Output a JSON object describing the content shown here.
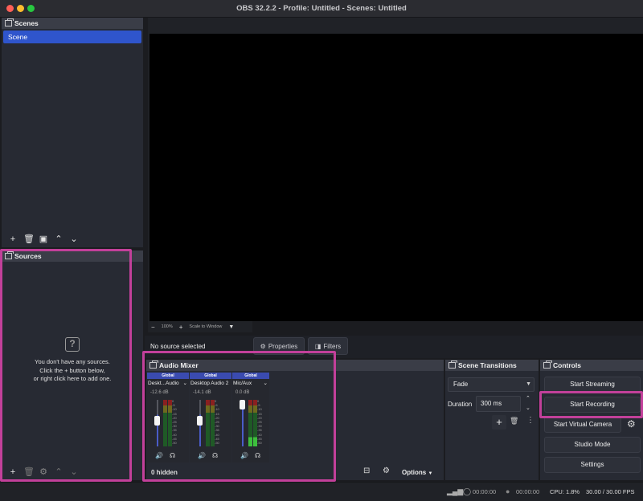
{
  "window": {
    "title": "OBS 32.2.2 - Profile: Untitled - Scenes: Untitled"
  },
  "scenes": {
    "title": "Scenes",
    "items": [
      "Scene"
    ]
  },
  "sources": {
    "title": "Sources",
    "empty_line1": "You don't have any sources.",
    "empty_line2": "Click the + button below,",
    "empty_line3": "or right click here to add one."
  },
  "preview": {
    "zoom": "100%",
    "scale_mode": "Scale to Window"
  },
  "context": {
    "no_source": "No source selected",
    "properties": "Properties",
    "filters": "Filters"
  },
  "mixer": {
    "title": "Audio Mixer",
    "hidden": "0 hidden",
    "options": "Options",
    "channels": [
      {
        "header": "Global",
        "name": "Deskt...Audio",
        "db": "-12.6 dB",
        "level": 0.68
      },
      {
        "header": "Global",
        "name": "Desktop Audio 2",
        "db": "-14.1 dB",
        "level": 0.66
      },
      {
        "header": "Global",
        "name": "Mic/Aux",
        "db": "0.0 dB",
        "level": 1.0
      }
    ],
    "scale": [
      "0",
      "-5",
      "-10",
      "-15",
      "-20",
      "-25",
      "-30",
      "-35",
      "-40",
      "-45",
      "-50",
      "-55",
      "-60"
    ]
  },
  "transitions": {
    "title": "Scene Transitions",
    "selected": "Fade",
    "duration_label": "Duration",
    "duration_value": "300 ms"
  },
  "controls": {
    "title": "Controls",
    "start_streaming": "Start Streaming",
    "start_recording": "Start Recording",
    "start_virtual_camera": "Start Virtual Camera",
    "studio_mode": "Studio Mode",
    "settings": "Settings"
  },
  "status": {
    "stream_time": "00:00:00",
    "record_time": "00:00:00",
    "cpu": "CPU: 1.8%",
    "fps": "30.00 / 30.00 FPS"
  },
  "colors": {
    "accent": "#2f55cc",
    "highlight": "#c2409a",
    "panel": "#272a33"
  }
}
